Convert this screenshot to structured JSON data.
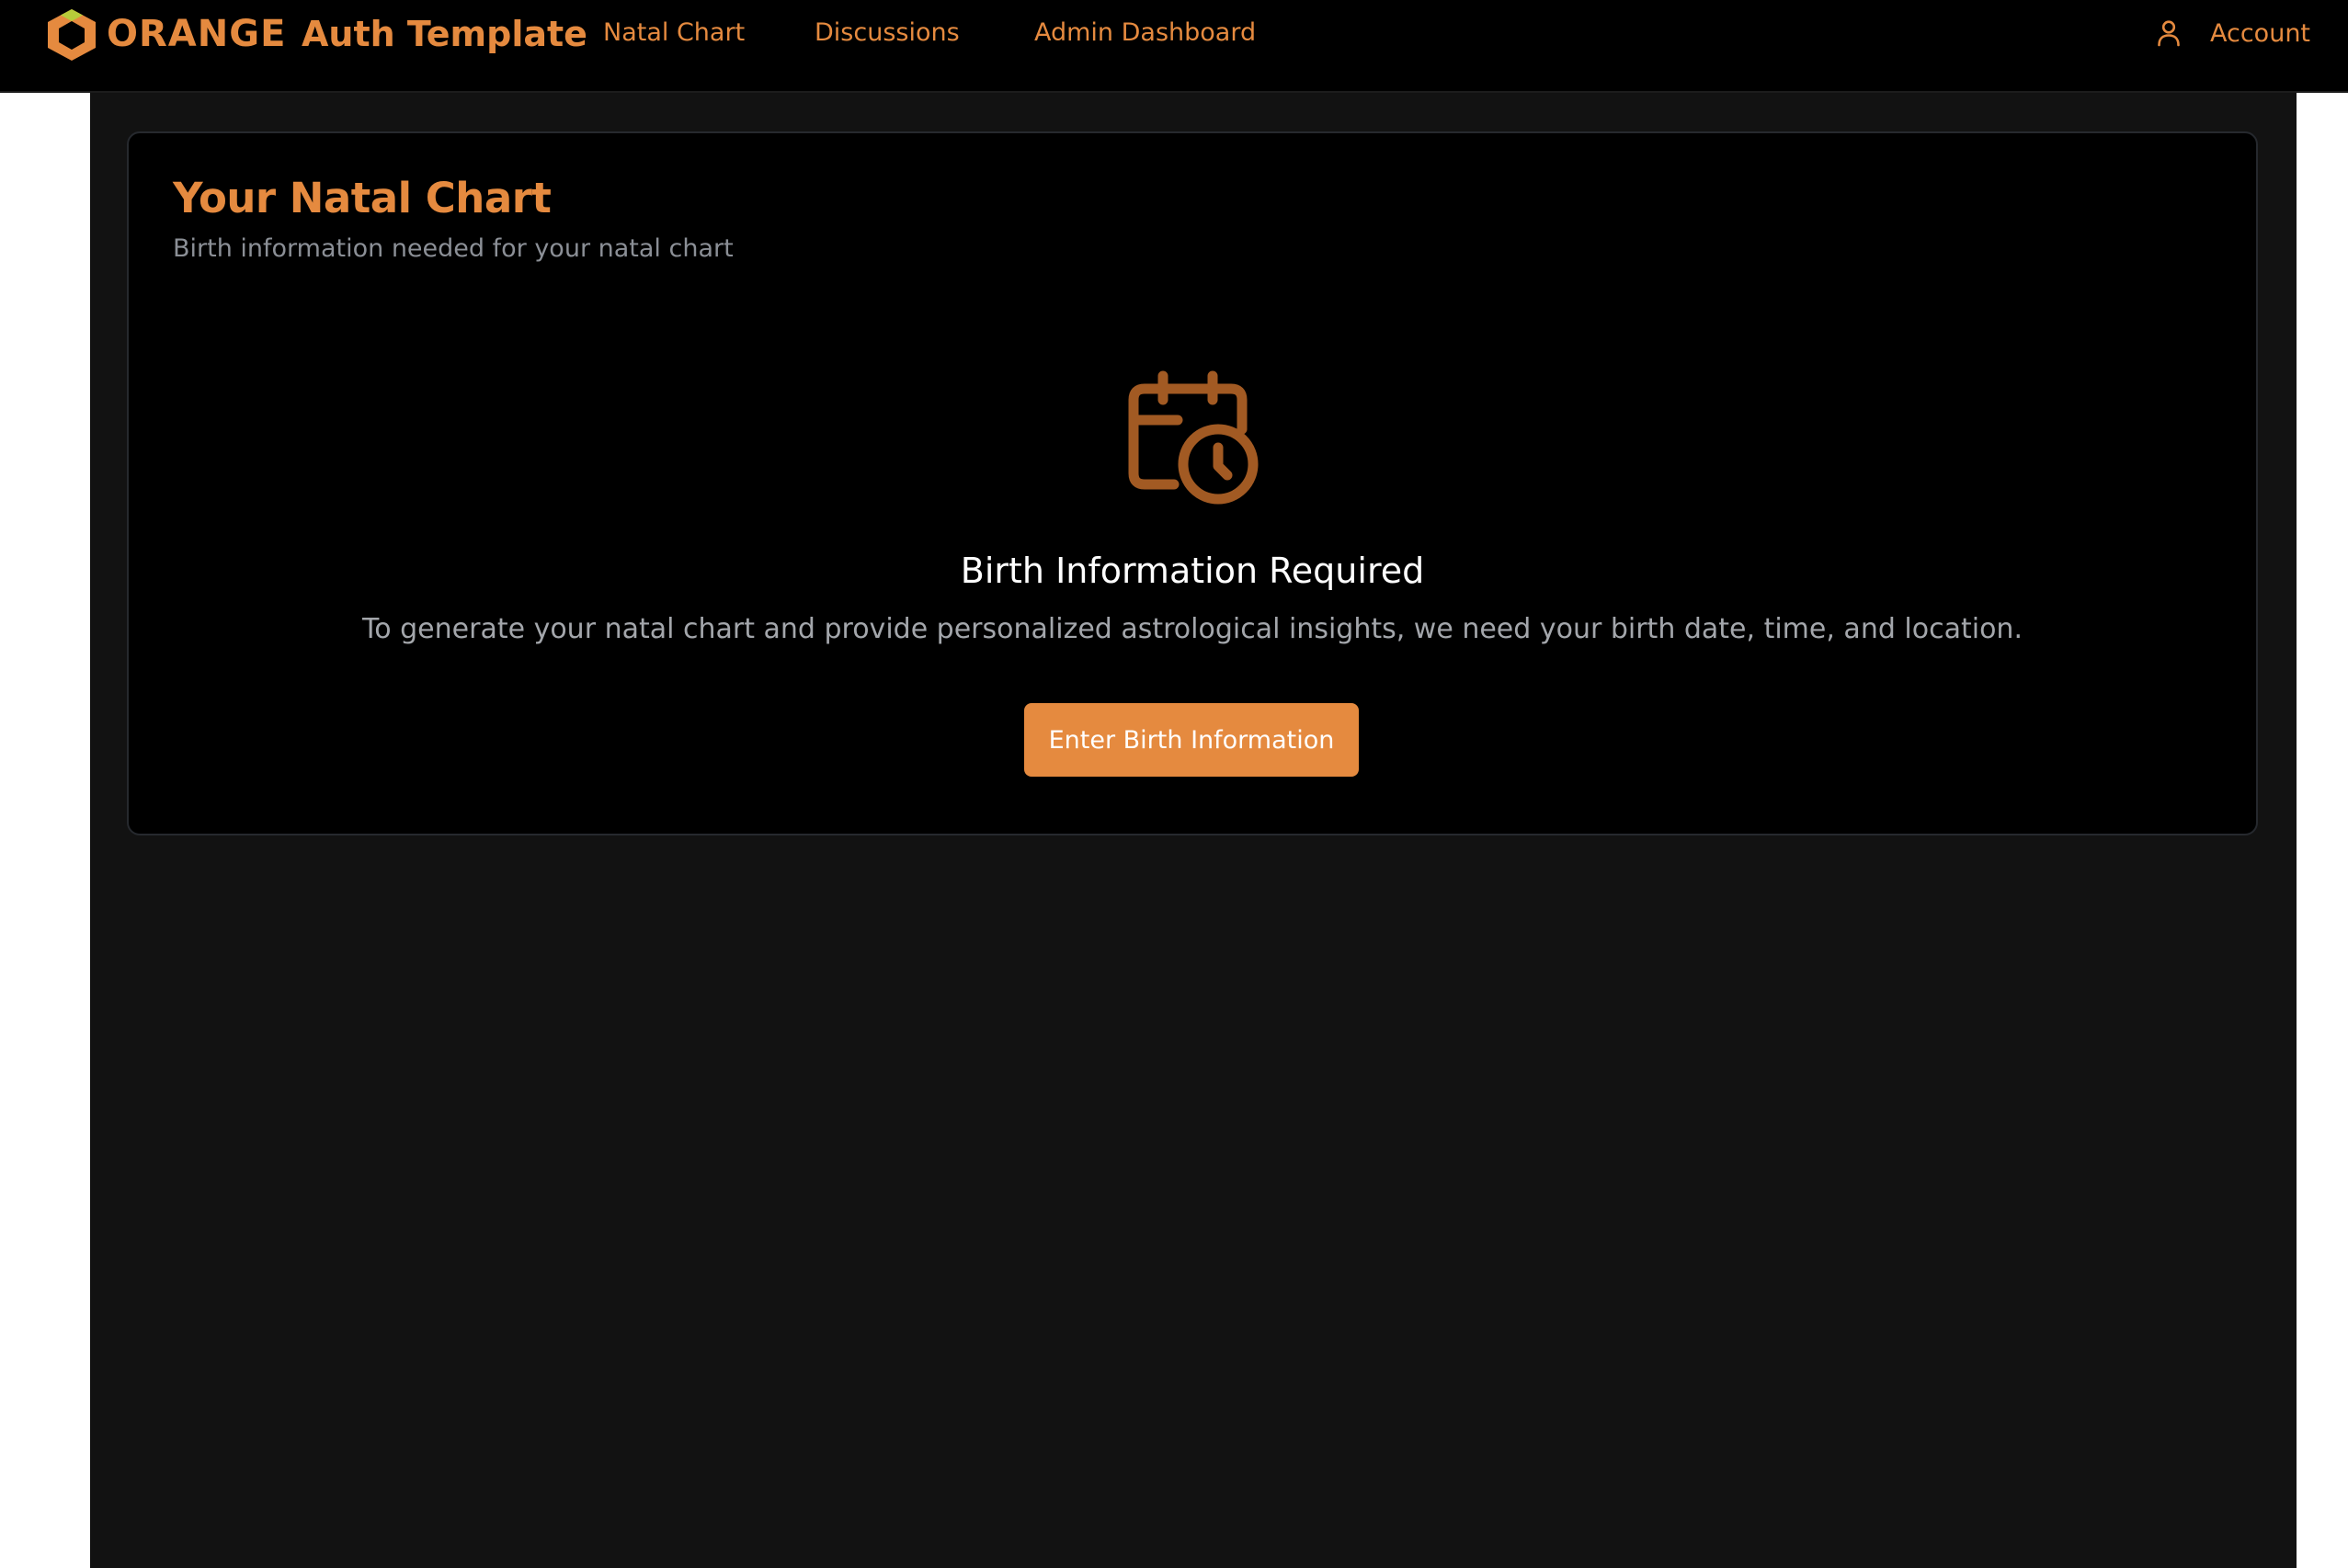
{
  "colors": {
    "accent": "#e58a3f",
    "nav_background": "#000000",
    "page_background": "#121212",
    "card_background": "#000000",
    "muted_text": "#8b8f96",
    "button_text": "#ffffff"
  },
  "navbar": {
    "logo_text": "ORANGE",
    "logo_icon": "hexagon-logo-icon",
    "brand_title": "Auth Template",
    "links": [
      {
        "label": "Natal Chart"
      },
      {
        "label": "Discussions"
      },
      {
        "label": "Admin Dashboard"
      }
    ],
    "account": {
      "label": "Account",
      "icon": "user-icon"
    }
  },
  "card": {
    "title": "Your Natal Chart",
    "subtitle": "Birth information needed for your natal chart",
    "empty_state": {
      "icon": "calendar-clock-icon",
      "title": "Birth Information Required",
      "description": "To generate your natal chart and provide personalized astrological insights, we need your birth date, time, and location.",
      "button_label": "Enter Birth Information"
    }
  }
}
